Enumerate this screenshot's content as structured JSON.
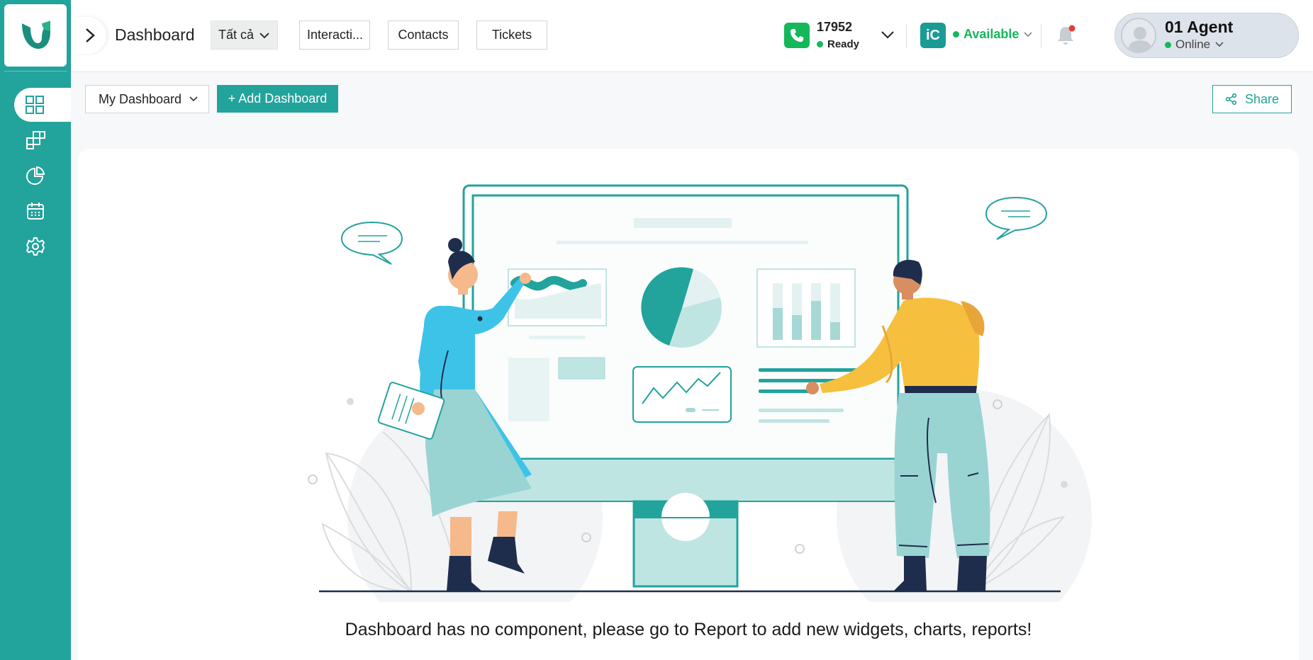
{
  "header": {
    "title": "Dashboard",
    "filters": [
      "Tất cả",
      "Interacti...",
      "Contacts",
      "Tickets"
    ]
  },
  "phone": {
    "extension": "17952",
    "status": "Ready"
  },
  "presence": {
    "status": "Available"
  },
  "agent": {
    "name": "01 Agent",
    "status": "Online"
  },
  "toolbar": {
    "dashboard_select": "My Dashboard",
    "add_dashboard": "+ Add Dashboard",
    "share": "Share"
  },
  "sidebar": {
    "items": [
      "dashboard-icon",
      "blocks-icon",
      "pie-chart-icon",
      "calendar-icon",
      "settings-icon"
    ]
  },
  "main": {
    "empty_message": "Dashboard has no component, please go to Report to add new widgets, charts, reports!"
  },
  "colors": {
    "brand": "#22a39c",
    "ready": "#14b85a",
    "notify": "#e83b3b"
  }
}
